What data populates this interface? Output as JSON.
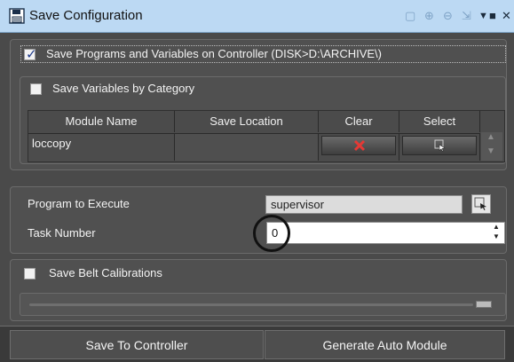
{
  "window": {
    "title": "Save Configuration"
  },
  "toolbar_icons": [
    "restore-icon",
    "zoom-in-icon",
    "zoom-out-icon",
    "zoom-fit-icon",
    "dropdown-icon",
    "maximize-icon",
    "close-icon"
  ],
  "save_programs": {
    "checked": true,
    "label": "Save Programs and Variables on Controller (DISK>D:\\ARCHIVE\\)"
  },
  "save_vars_by_category": {
    "checked": false,
    "label": "Save Variables by Category"
  },
  "module_table": {
    "columns": [
      "Module Name",
      "Save Location",
      "Clear",
      "Select"
    ],
    "rows": [
      {
        "module_name": "loccopy",
        "save_location": ""
      }
    ]
  },
  "program": {
    "label": "Program to Execute",
    "value": "supervisor"
  },
  "task": {
    "label": "Task Number",
    "value": "0"
  },
  "belt": {
    "checked": false,
    "label": "Save Belt Calibrations"
  },
  "buttons": {
    "save_to_controller": "Save To Controller",
    "generate_auto_module": "Generate Auto Module"
  },
  "colors": {
    "panel_bg": "#4a4a4a",
    "title_bar_bg": "#bcd9f3",
    "clear_x": "#e53935"
  }
}
